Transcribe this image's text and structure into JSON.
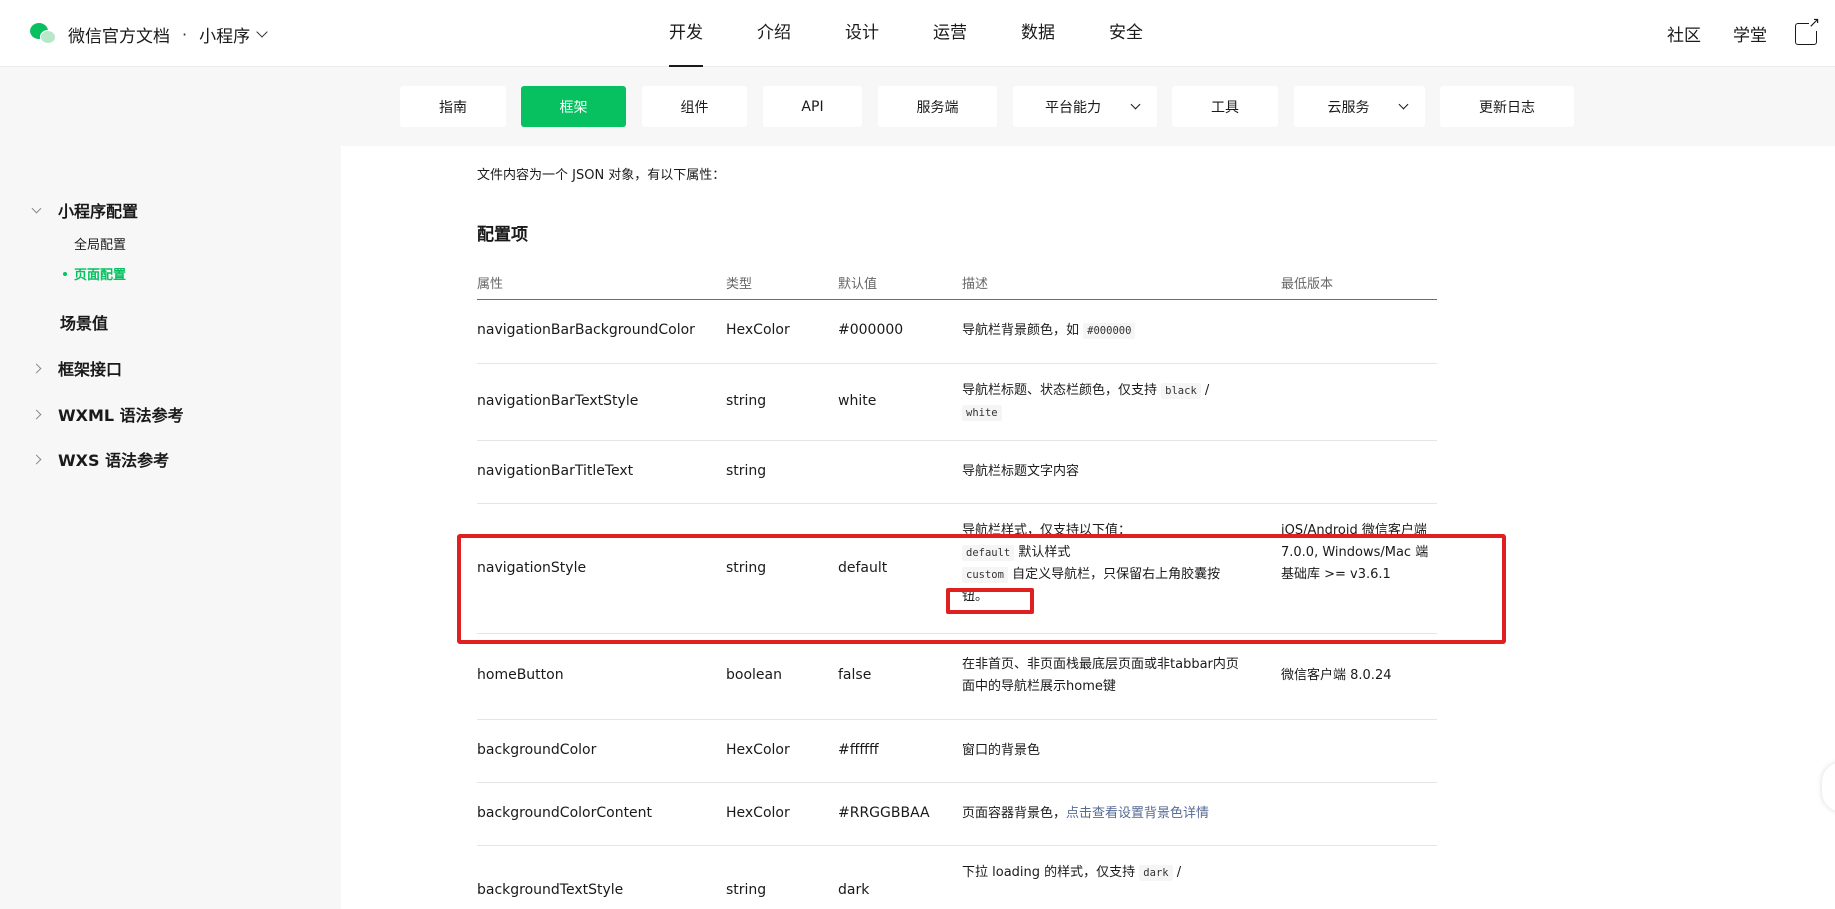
{
  "header": {
    "brand_title": "微信官方文档",
    "brand_separator": "·",
    "product_selector": "小程序",
    "nav": [
      "开发",
      "介绍",
      "设计",
      "运营",
      "数据",
      "安全"
    ],
    "active_nav": "开发",
    "right_links": [
      "社区",
      "学堂"
    ],
    "icons": [
      "wechat-logo-icon",
      "chevron-down-icon",
      "external-link-icon"
    ]
  },
  "subnav": {
    "tabs": [
      "指南",
      "框架",
      "组件",
      "API",
      "服务端",
      "平台能力",
      "工具",
      "云服务",
      "更新日志"
    ],
    "active_tab": "框架",
    "accent_color": "#07c160"
  },
  "sidebar": {
    "groups": [
      {
        "label": "小程序配置",
        "expanded": true,
        "items": [
          "全局配置",
          "页面配置"
        ]
      },
      {
        "label": "场景值"
      },
      {
        "label": "框架接口"
      },
      {
        "label": "WXML 语法参考"
      },
      {
        "label": "WXS 语法参考"
      }
    ],
    "active_item": "页面配置"
  },
  "content": {
    "intro": "文件内容为一个 JSON 对象，有以下属性：",
    "section_title": "配置项",
    "table": {
      "headers": [
        "属性",
        "类型",
        "默认值",
        "描述",
        "最低版本"
      ],
      "rows": [
        {
          "attr": "navigationBarBackgroundColor",
          "type": "HexColor",
          "default": "#000000",
          "desc_text": "导航栏背景颜色，如",
          "desc_code": "#000000",
          "version": ""
        },
        {
          "attr": "navigationBarTextStyle",
          "type": "string",
          "default": "white",
          "desc_text": "导航栏标题、状态栏颜色，仅支持",
          "desc_code1": "black",
          "desc_sep": "/",
          "desc_code2": "white",
          "version": ""
        },
        {
          "attr": "navigationBarTitleText",
          "type": "string",
          "default": "",
          "desc_text": "导航栏标题文字内容",
          "version": ""
        },
        {
          "attr": "navigationStyle",
          "type": "string",
          "default": "default",
          "desc_line1": "导航栏样式，仅支持以下值：",
          "desc_code1": "default",
          "desc_text1": "默认样式",
          "desc_code2": "custom",
          "desc_text2": "自定义导航栏，只保留右上角胶囊按钮。",
          "version": "iOS/Android 微信客户端 7.0.0, Windows/Mac 端基础库 >= v3.6.1"
        },
        {
          "attr": "homeButton",
          "type": "boolean",
          "default": "false",
          "desc_text": "在非首页、非页面栈最底层页面或非tabbar内页面中的导航栏展示home键",
          "version": "微信客户端 8.0.24"
        },
        {
          "attr": "backgroundColor",
          "type": "HexColor",
          "default": "#ffffff",
          "desc_text": "窗口的背景色",
          "version": ""
        },
        {
          "attr": "backgroundColorContent",
          "type": "HexColor",
          "default": "#RRGGBBAA",
          "desc_text": "页面容器背景色，",
          "desc_link": "点击查看设置背景色详情",
          "version": ""
        },
        {
          "attr": "backgroundTextStyle",
          "type": "string",
          "default": "dark",
          "desc_text": "下拉 loading 的样式，仅支持",
          "desc_code": "dark",
          "desc_sep": "/",
          "version": ""
        }
      ]
    },
    "highlight_color": "#e02020"
  }
}
